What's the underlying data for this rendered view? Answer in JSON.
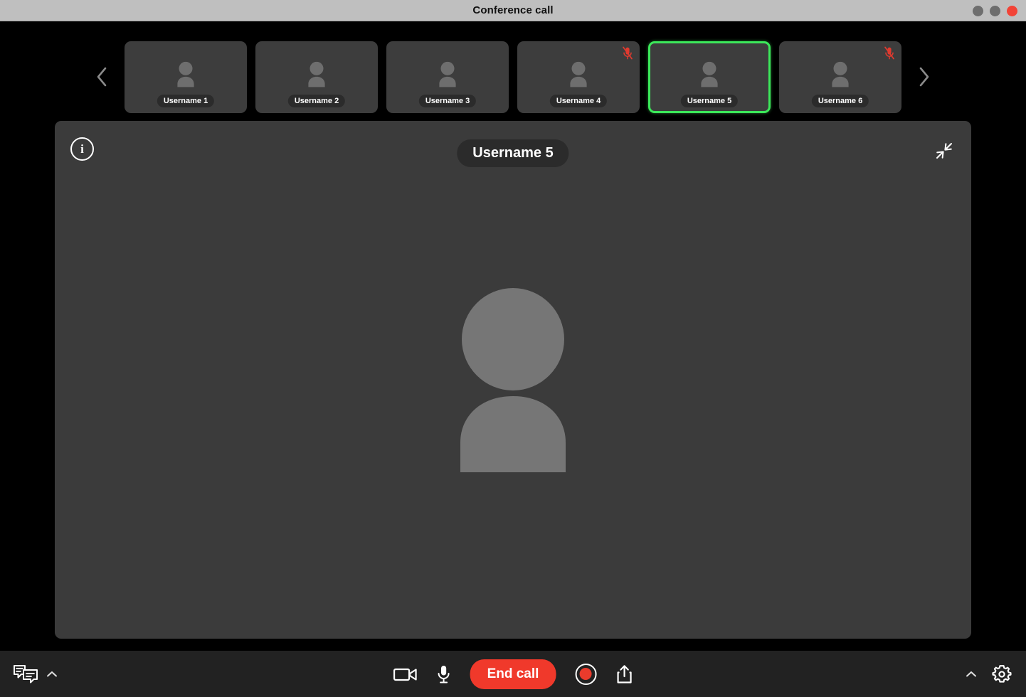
{
  "window": {
    "title": "Conference call",
    "buttons": [
      {
        "name": "minimize",
        "color": "#6e6e6e"
      },
      {
        "name": "maximize",
        "color": "#6e6e6e"
      },
      {
        "name": "close",
        "color": "#f24336"
      }
    ]
  },
  "filmstrip": {
    "prev_label": "‹",
    "next_label": "›",
    "participants": [
      {
        "name": "Username 1",
        "muted": false,
        "active": false
      },
      {
        "name": "Username 2",
        "muted": false,
        "active": false
      },
      {
        "name": "Username 3",
        "muted": false,
        "active": false
      },
      {
        "name": "Username 4",
        "muted": true,
        "active": false
      },
      {
        "name": "Username 5",
        "muted": false,
        "active": true
      },
      {
        "name": "Username 6",
        "muted": true,
        "active": false
      }
    ]
  },
  "main_view": {
    "speaker_name": "Username 5",
    "info_label": "i",
    "info_icon": "info-circle-icon",
    "collapse_icon": "collapse-arrows-icon"
  },
  "controls": {
    "chat_icon": "chat-bubbles-icon",
    "chat_chevron_icon": "chevron-up-icon",
    "camera_icon": "video-camera-icon",
    "microphone_icon": "microphone-icon",
    "end_call_label": "End call",
    "record_icon": "record-circle-icon",
    "share_icon": "share-upload-icon",
    "settings_chevron_icon": "chevron-up-icon",
    "settings_icon": "gear-icon"
  },
  "colors": {
    "accent_green": "#3ce85a",
    "danger_red": "#f0392b",
    "mute_red": "#e03a2f",
    "panel_bg": "#3b3b3b",
    "thumb_bg": "#3d3d3d",
    "bottom_bar": "#222222",
    "titlebar": "#bfbfbf"
  }
}
